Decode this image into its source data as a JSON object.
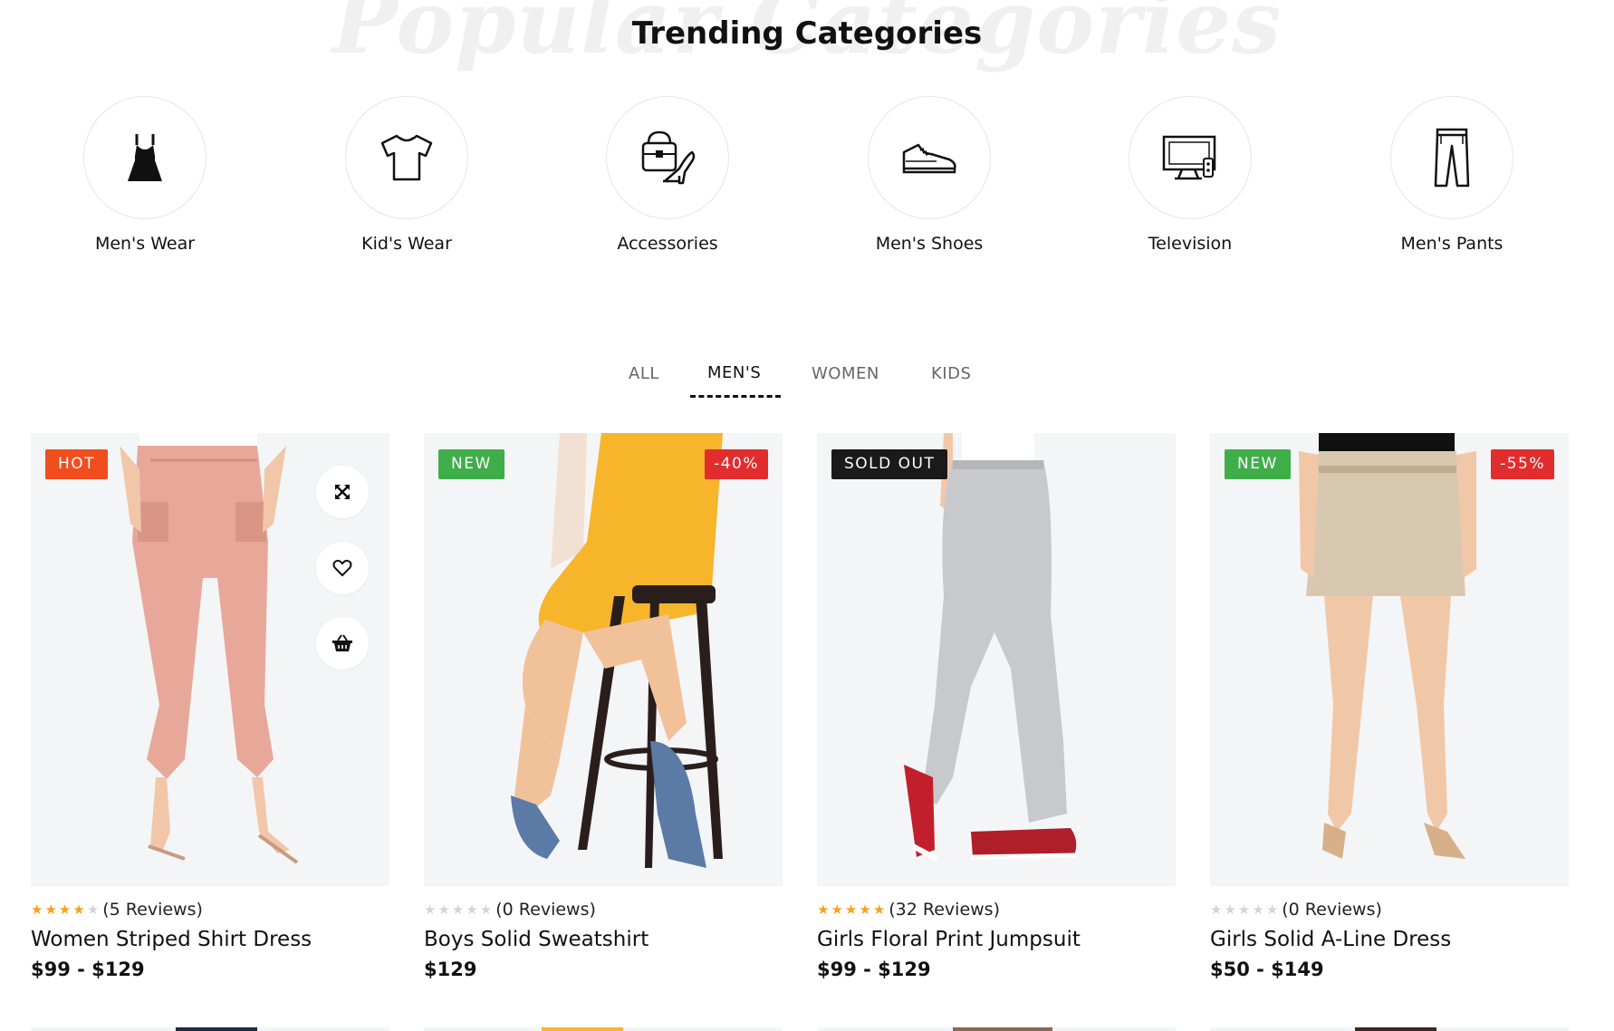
{
  "section": {
    "background_word": "Popular Categories",
    "title": "Trending Categories"
  },
  "categories": [
    {
      "label": "Men's Wear",
      "icon": "dress-icon"
    },
    {
      "label": "Kid's Wear",
      "icon": "tshirt-icon"
    },
    {
      "label": "Accessories",
      "icon": "bag-heel-icon"
    },
    {
      "label": "Men's Shoes",
      "icon": "sneaker-icon"
    },
    {
      "label": "Television",
      "icon": "tv-icon"
    },
    {
      "label": "Men's Pants",
      "icon": "pants-icon"
    }
  ],
  "tabs": [
    {
      "label": "ALL",
      "active": false
    },
    {
      "label": "MEN'S",
      "active": true
    },
    {
      "label": "WOMEN",
      "active": false
    },
    {
      "label": "KIDS",
      "active": false
    }
  ],
  "products": [
    {
      "badge_left": "HOT",
      "badge_right": "",
      "rating": 4,
      "reviews": "(5 Reviews)",
      "name": "Women Striped Shirt Dress",
      "price": "$99 - $129",
      "image": "pink-joggers-photo"
    },
    {
      "badge_left": "NEW",
      "badge_right": "-40%",
      "rating": 0,
      "reviews": "(0 Reviews)",
      "name": "Boys Solid Sweatshirt",
      "price": "$129",
      "image": "yellow-dress-stool-photo"
    },
    {
      "badge_left": "SOLD OUT",
      "badge_right": "",
      "rating": 5,
      "reviews": "(32 Reviews)",
      "name": "Girls Floral Print Jumpsuit",
      "price": "$99 - $129",
      "image": "grey-sweatpants-photo"
    },
    {
      "badge_left": "NEW",
      "badge_right": "-55%",
      "rating": 0,
      "reviews": "(0 Reviews)",
      "name": "Girls Solid A-Line Dress",
      "price": "$50 - $149",
      "image": "beige-skirt-photo"
    }
  ],
  "colors": {
    "hot": "#f04e1e",
    "new": "#3fae49",
    "sold_out": "#1a1a1a",
    "sale": "#e12d2d",
    "star": "#f7a21b"
  }
}
